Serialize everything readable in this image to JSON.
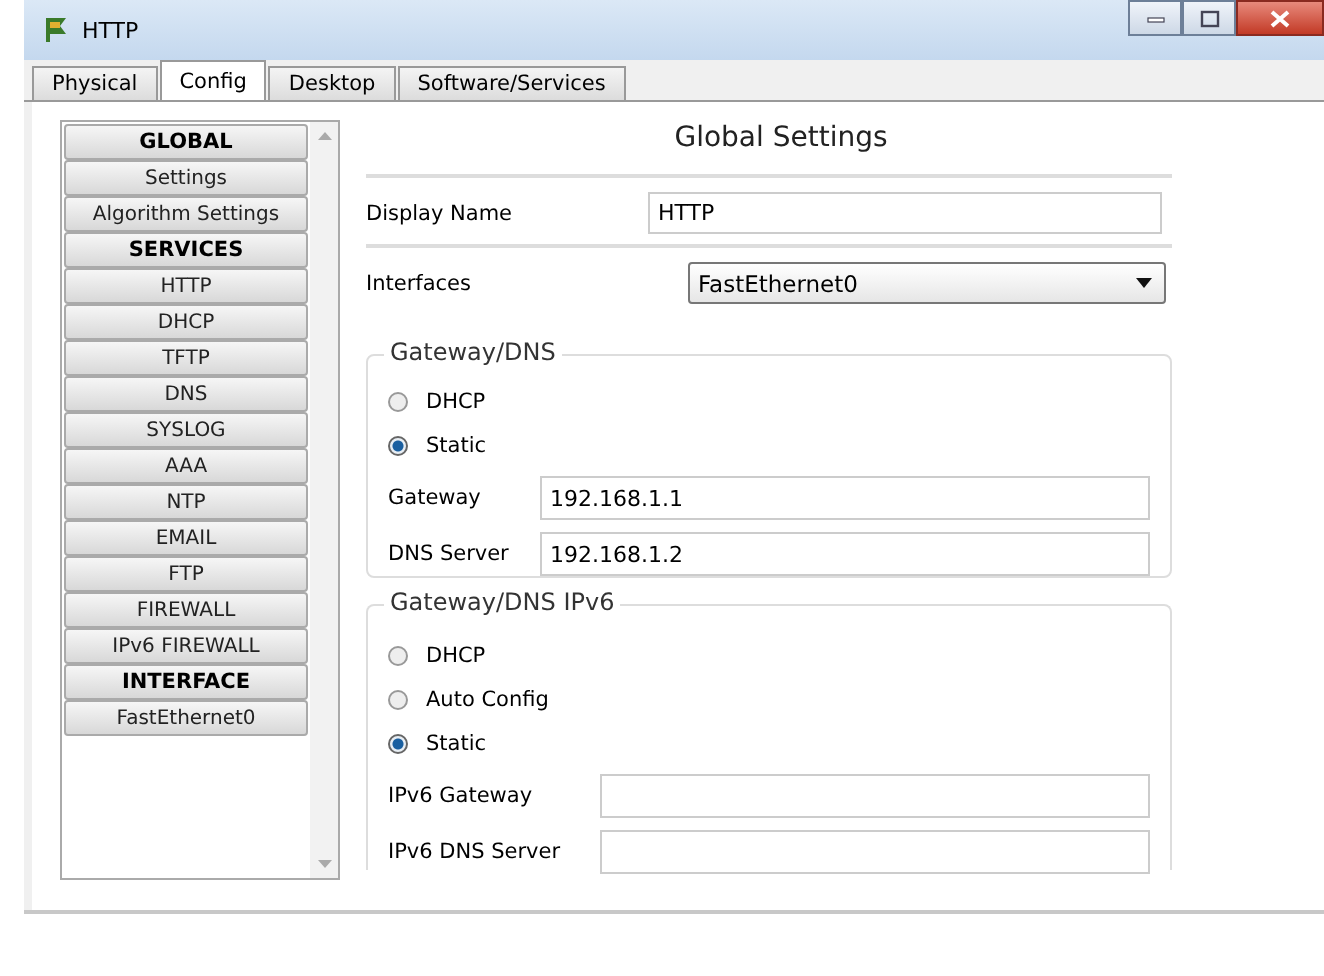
{
  "window": {
    "title": "HTTP"
  },
  "tabs": [
    {
      "label": "Physical",
      "selected": false
    },
    {
      "label": "Config",
      "selected": true
    },
    {
      "label": "Desktop",
      "selected": false
    },
    {
      "label": "Software/Services",
      "selected": false
    }
  ],
  "sidebar": {
    "items": [
      {
        "label": "GLOBAL",
        "kind": "header"
      },
      {
        "label": "Settings",
        "kind": "item"
      },
      {
        "label": "Algorithm Settings",
        "kind": "item"
      },
      {
        "label": "SERVICES",
        "kind": "header"
      },
      {
        "label": "HTTP",
        "kind": "item"
      },
      {
        "label": "DHCP",
        "kind": "item"
      },
      {
        "label": "TFTP",
        "kind": "item"
      },
      {
        "label": "DNS",
        "kind": "item"
      },
      {
        "label": "SYSLOG",
        "kind": "item"
      },
      {
        "label": "AAA",
        "kind": "item"
      },
      {
        "label": "NTP",
        "kind": "item"
      },
      {
        "label": "EMAIL",
        "kind": "item"
      },
      {
        "label": "FTP",
        "kind": "item"
      },
      {
        "label": "FIREWALL",
        "kind": "item"
      },
      {
        "label": "IPv6 FIREWALL",
        "kind": "item"
      },
      {
        "label": "INTERFACE",
        "kind": "header"
      },
      {
        "label": "FastEthernet0",
        "kind": "item"
      }
    ]
  },
  "panel": {
    "title": "Global Settings",
    "display_name": {
      "label": "Display Name",
      "value": "HTTP"
    },
    "interfaces": {
      "label": "Interfaces",
      "value": "FastEthernet0"
    },
    "groups": [
      {
        "legend": "Gateway/DNS",
        "options": [
          {
            "label": "DHCP",
            "selected": false
          },
          {
            "label": "Static",
            "selected": true
          }
        ],
        "fields": [
          {
            "label": "Gateway",
            "value": "192.168.1.1"
          },
          {
            "label": "DNS Server",
            "value": "192.168.1.2"
          }
        ]
      },
      {
        "legend": "Gateway/DNS IPv6",
        "options": [
          {
            "label": "DHCP",
            "selected": false
          },
          {
            "label": "Auto Config",
            "selected": false
          },
          {
            "label": "Static",
            "selected": true
          }
        ],
        "fields": [
          {
            "label": "IPv6 Gateway"
          },
          {
            "label": "IPv6 DNS Server"
          }
        ]
      }
    ]
  }
}
